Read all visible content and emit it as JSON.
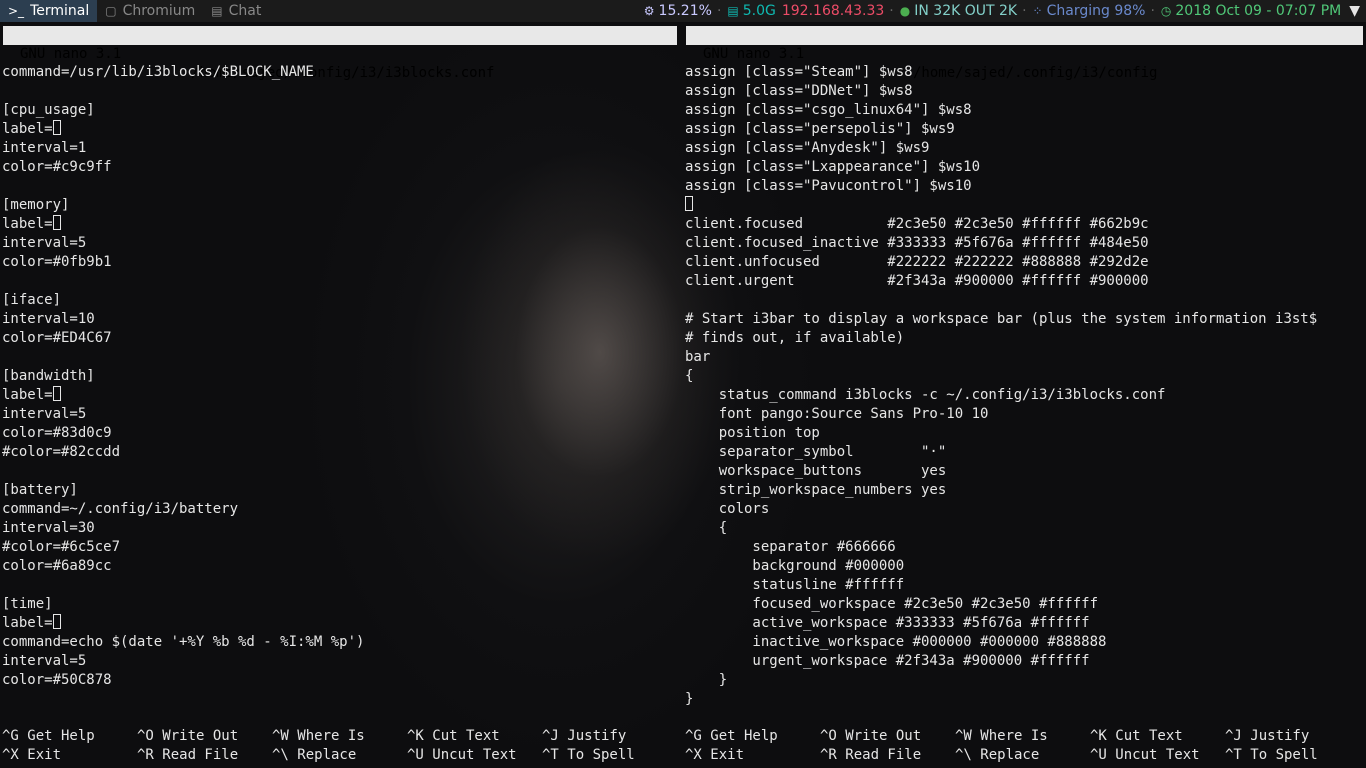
{
  "workspaces": [
    {
      "icon": "terminal-icon",
      "glyph": ">_",
      "label": "Terminal",
      "active": true
    },
    {
      "icon": "browser-icon",
      "glyph": "▢",
      "label": "Chromium",
      "active": false
    },
    {
      "icon": "chat-icon",
      "glyph": "▤",
      "label": "Chat",
      "active": false
    }
  ],
  "status": {
    "cpu": {
      "glyph": "⚙",
      "text": "15.21%",
      "color": "#c9c9ff"
    },
    "memory": {
      "glyph": "▤",
      "text": "5.0G",
      "color": "#0fb9b1"
    },
    "iface": {
      "text": "192.168.43.33",
      "color": "#ED4C67"
    },
    "bandwidth": {
      "glyph": "●",
      "text": "IN 32K OUT 2K",
      "color": "#83d0c9"
    },
    "battery": {
      "glyph": "⁘",
      "text": "Charging 98%",
      "color": "#6a89cc"
    },
    "time": {
      "glyph": "◷",
      "text": "2018 Oct 09 - 07:07 PM",
      "color": "#50C878"
    },
    "wifi_glyph": "▼",
    "separator": "·"
  },
  "left_pane": {
    "title_version": "GNU nano 3.1",
    "title_file": "/home/sajed/.config/i3/i3blocks.conf",
    "lines": [
      "command=/usr/lib/i3blocks/$BLOCK_NAME",
      "",
      "[cpu_usage]",
      "label=",
      "interval=1",
      "color=#c9c9ff",
      "",
      "[memory]",
      "label=",
      "interval=5",
      "color=#0fb9b1",
      "",
      "[iface]",
      "interval=10",
      "color=#ED4C67",
      "",
      "[bandwidth]",
      "label=",
      "interval=5",
      "color=#83d0c9",
      "#color=#82ccdd",
      "",
      "[battery]",
      "command=~/.config/i3/battery",
      "interval=30",
      "#color=#6c5ce7",
      "color=#6a89cc",
      "",
      "[time]",
      "label=",
      "command=echo $(date '+%Y %b %d - %I:%M %p')",
      "interval=5",
      "color=#50C878"
    ]
  },
  "right_pane": {
    "title_version": "GNU nano 3.1",
    "title_file": "/home/sajed/.config/i3/config",
    "lines": [
      "assign [class=\"Steam\"] $ws8",
      "assign [class=\"DDNet\"] $ws8",
      "assign [class=\"csgo_linux64\"] $ws8",
      "assign [class=\"persepolis\"] $ws9",
      "assign [class=\"Anydesk\"] $ws9",
      "assign [class=\"Lxappearance\"] $ws10",
      "assign [class=\"Pavucontrol\"] $ws10",
      "",
      "client.focused          #2c3e50 #2c3e50 #ffffff #662b9c",
      "client.focused_inactive #333333 #5f676a #ffffff #484e50",
      "client.unfocused        #222222 #222222 #888888 #292d2e",
      "client.urgent           #2f343a #900000 #ffffff #900000",
      "",
      "# Start i3bar to display a workspace bar (plus the system information i3st$",
      "# finds out, if available)",
      "bar",
      "{",
      "    status_command i3blocks -c ~/.config/i3/i3blocks.conf",
      "    font pango:Source Sans Pro-10 10",
      "    position top",
      "    separator_symbol        \"·\"",
      "    workspace_buttons       yes",
      "    strip_workspace_numbers yes",
      "    colors",
      "    {",
      "        separator #666666",
      "        background #000000",
      "        statusline #ffffff",
      "        focused_workspace #2c3e50 #2c3e50 #ffffff",
      "        active_workspace #333333 #5f676a #ffffff",
      "        inactive_workspace #000000 #000000 #888888",
      "        urgent_workspace #2f343a #900000 #ffffff",
      "    }",
      "}"
    ]
  },
  "shortcuts": [
    [
      {
        "key": "^G",
        "label": "Get Help"
      },
      {
        "key": "^O",
        "label": "Write Out"
      },
      {
        "key": "^W",
        "label": "Where Is"
      },
      {
        "key": "^K",
        "label": "Cut Text"
      },
      {
        "key": "^J",
        "label": "Justify"
      }
    ],
    [
      {
        "key": "^X",
        "label": "Exit"
      },
      {
        "key": "^R",
        "label": "Read File"
      },
      {
        "key": "^\\",
        "label": "Replace"
      },
      {
        "key": "^U",
        "label": "Uncut Text"
      },
      {
        "key": "^T",
        "label": "To Spell"
      }
    ]
  ]
}
